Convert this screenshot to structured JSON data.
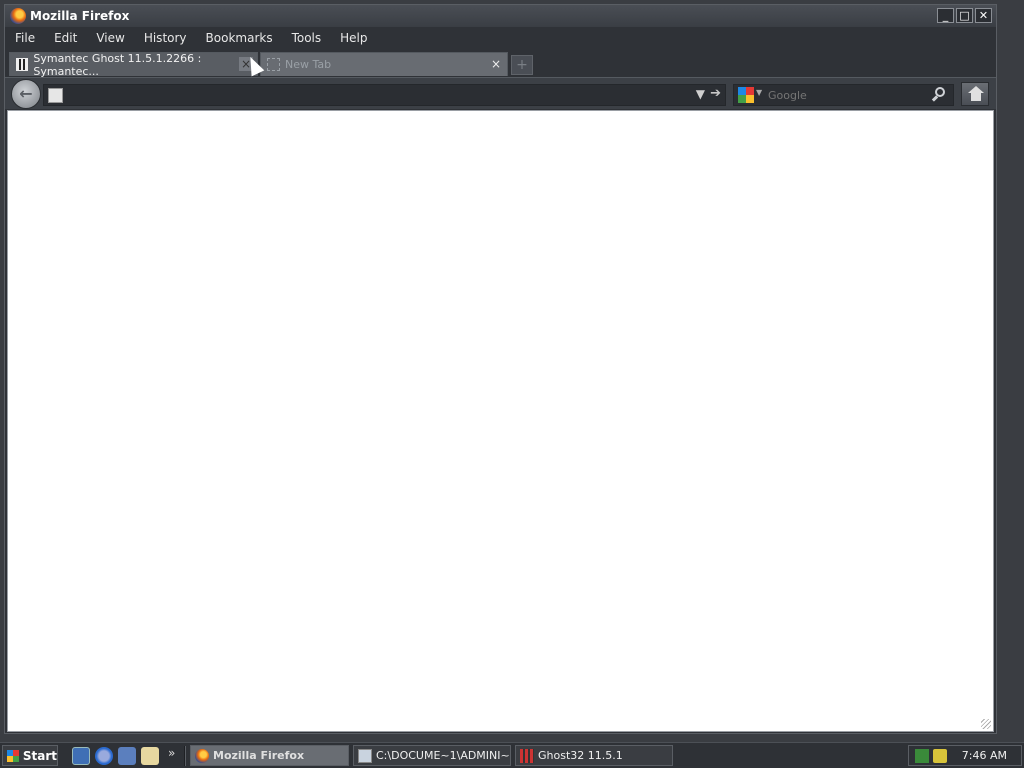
{
  "window": {
    "title": "Mozilla Firefox",
    "controls": {
      "minimize": "_",
      "maximize": "□",
      "close": "✕"
    }
  },
  "menu": [
    "File",
    "Edit",
    "View",
    "History",
    "Bookmarks",
    "Tools",
    "Help"
  ],
  "tabs": [
    {
      "label": "Symantec Ghost 11.5.1.2266 : Symantec...",
      "active": true,
      "icon": "ghost-icon"
    },
    {
      "label": "New Tab",
      "active": false,
      "icon": "blank-page-icon"
    }
  ],
  "tab_close_glyph": "×",
  "new_tab_glyph": "+",
  "nav": {
    "back_glyph": "←",
    "url_value": "",
    "dropdown_glyph": "▼",
    "go_glyph": "➔",
    "search_placeholder": "Google",
    "search_caret": "▼"
  },
  "taskbar": {
    "start_label": "Start",
    "quicklaunch_more": "»",
    "tasks": [
      {
        "label": "Mozilla Firefox",
        "active": true
      },
      {
        "label": "C:\\DOCUME~1\\ADMINI~...",
        "active": false
      },
      {
        "label": "Ghost32 11.5.1",
        "active": false
      }
    ],
    "clock": "7:46 AM"
  },
  "colors": {
    "chrome_dark": "#2f3237",
    "content_bg": "#ffffff",
    "active_task": "#696d73"
  }
}
